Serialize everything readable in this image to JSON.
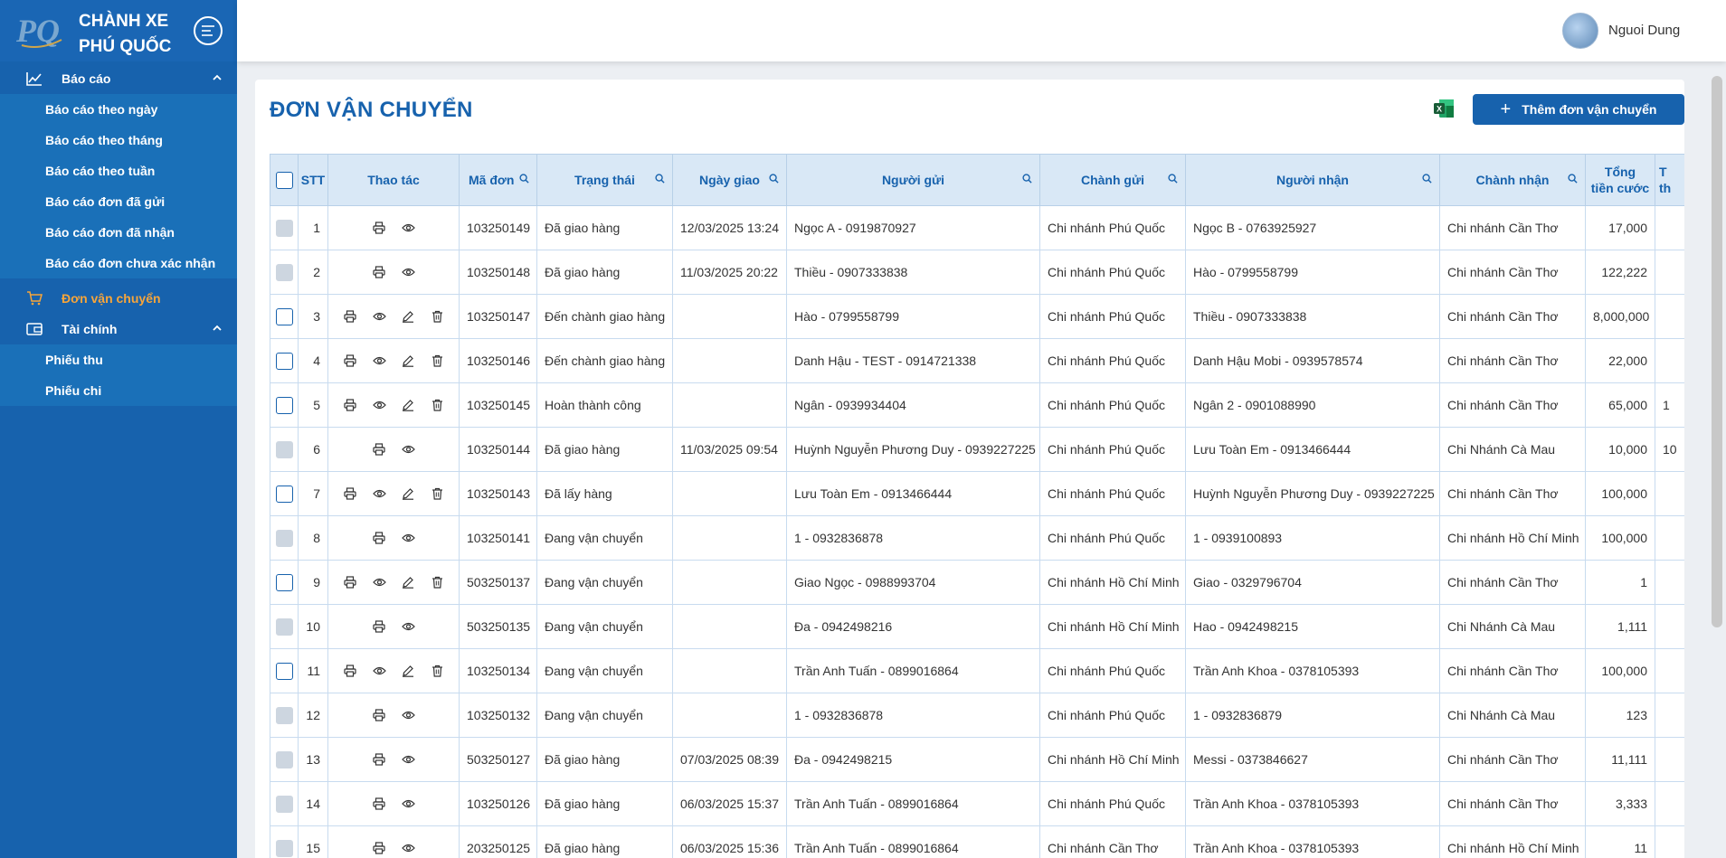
{
  "sidebar": {
    "brand_line1": "CHÀNH XE",
    "brand_line2": "PHÚ QUỐC",
    "logo_text": "PQ",
    "reports": {
      "label": "Báo cáo",
      "items": [
        "Báo cáo theo ngày",
        "Báo cáo theo tháng",
        "Báo cáo theo tuần",
        "Báo cáo đơn đã gửi",
        "Báo cáo đơn đã nhận",
        "Báo cáo đơn chưa xác nhận"
      ]
    },
    "shipping": {
      "label": "Đơn vận chuyển"
    },
    "finance": {
      "label": "Tài chính",
      "items": [
        "Phiếu thu",
        "Phiếu chi"
      ]
    }
  },
  "topbar": {
    "user_name": "Nguoi Dung"
  },
  "page": {
    "title": "ĐƠN VẬN CHUYỂN",
    "add_button": "Thêm đơn vận chuyển"
  },
  "table": {
    "headers": {
      "stt": "STT",
      "actions": "Thao tác",
      "code": "Mã đơn",
      "status": "Trạng thái",
      "delivery_date": "Ngày giao",
      "sender": "Người gửi",
      "send_branch": "Chành gửi",
      "receiver": "Người nhận",
      "receive_branch": "Chành nhận",
      "total_line1": "Tổng",
      "total_line2": "tiền cước",
      "next_line1": "T",
      "next_line2": "th"
    },
    "rows": [
      {
        "stt": "1",
        "editable": false,
        "code": "103250149",
        "status": "Đã giao hàng",
        "date": "12/03/2025 13:24",
        "sender": "Ngọc A - 0919870927",
        "send_branch": "Chi nhánh Phú Quốc",
        "receiver": "Ngọc B - 0763925927",
        "receive_branch": "Chi nhánh Cần Thơ",
        "total": "17,000",
        "next": ""
      },
      {
        "stt": "2",
        "editable": false,
        "code": "103250148",
        "status": "Đã giao hàng",
        "date": "11/03/2025 20:22",
        "sender": "Thiều - 0907333838",
        "send_branch": "Chi nhánh Phú Quốc",
        "receiver": "Hào - 0799558799",
        "receive_branch": "Chi nhánh Cần Thơ",
        "total": "122,222",
        "next": ""
      },
      {
        "stt": "3",
        "editable": true,
        "code": "103250147",
        "status": "Đến chành giao hàng",
        "date": "",
        "sender": "Hào - 0799558799",
        "send_branch": "Chi nhánh Phú Quốc",
        "receiver": "Thiều - 0907333838",
        "receive_branch": "Chi nhánh Cần Thơ",
        "total": "8,000,000",
        "next": ""
      },
      {
        "stt": "4",
        "editable": true,
        "code": "103250146",
        "status": "Đến chành giao hàng",
        "date": "",
        "sender": "Danh Hậu - TEST - 0914721338",
        "send_branch": "Chi nhánh Phú Quốc",
        "receiver": "Danh Hậu Mobi - 0939578574",
        "receive_branch": "Chi nhánh Cần Thơ",
        "total": "22,000",
        "next": ""
      },
      {
        "stt": "5",
        "editable": true,
        "code": "103250145",
        "status": "Hoàn thành công",
        "date": "",
        "sender": "Ngân - 0939934404",
        "send_branch": "Chi nhánh Phú Quốc",
        "receiver": "Ngân 2 - 0901088990",
        "receive_branch": "Chi nhánh Cần Thơ",
        "total": "65,000",
        "next": "1"
      },
      {
        "stt": "6",
        "editable": false,
        "code": "103250144",
        "status": "Đã giao hàng",
        "date": "11/03/2025 09:54",
        "sender": "Huỳnh Nguyễn Phương Duy - 0939227225",
        "send_branch": "Chi nhánh Phú Quốc",
        "receiver": "Lưu Toàn Em - 0913466444",
        "receive_branch": "Chi Nhánh Cà Mau",
        "total": "10,000",
        "next": "10"
      },
      {
        "stt": "7",
        "editable": true,
        "code": "103250143",
        "status": "Đã lấy hàng",
        "date": "",
        "sender": "Lưu Toàn Em - 0913466444",
        "send_branch": "Chi nhánh Phú Quốc",
        "receiver": "Huỳnh Nguyễn Phương Duy - 0939227225",
        "receive_branch": "Chi nhánh Cần Thơ",
        "total": "100,000",
        "next": ""
      },
      {
        "stt": "8",
        "editable": false,
        "code": "103250141",
        "status": "Đang vận chuyển",
        "date": "",
        "sender": "1 - 0932836878",
        "send_branch": "Chi nhánh Phú Quốc",
        "receiver": "1 - 0939100893",
        "receive_branch": "Chi nhánh Hồ Chí Minh",
        "total": "100,000",
        "next": ""
      },
      {
        "stt": "9",
        "editable": true,
        "code": "503250137",
        "status": "Đang vận chuyển",
        "date": "",
        "sender": "Giao Ngọc - 0988993704",
        "send_branch": "Chi nhánh Hồ Chí Minh",
        "receiver": "Giao - 0329796704",
        "receive_branch": "Chi nhánh Cần Thơ",
        "total": "1",
        "next": ""
      },
      {
        "stt": "10",
        "editable": false,
        "code": "503250135",
        "status": "Đang vận chuyển",
        "date": "",
        "sender": "Đa - 0942498216",
        "send_branch": "Chi nhánh Hồ Chí Minh",
        "receiver": "Hao - 0942498215",
        "receive_branch": "Chi Nhánh Cà Mau",
        "total": "1,111",
        "next": ""
      },
      {
        "stt": "11",
        "editable": true,
        "code": "103250134",
        "status": "Đang vận chuyển",
        "date": "",
        "sender": "Trần Anh Tuấn - 0899016864",
        "send_branch": "Chi nhánh Phú Quốc",
        "receiver": "Trần Anh Khoa - 0378105393",
        "receive_branch": "Chi nhánh Cần Thơ",
        "total": "100,000",
        "next": ""
      },
      {
        "stt": "12",
        "editable": false,
        "code": "103250132",
        "status": "Đang vận chuyển",
        "date": "",
        "sender": "1 - 0932836878",
        "send_branch": "Chi nhánh Phú Quốc",
        "receiver": "1 - 0932836879",
        "receive_branch": "Chi Nhánh Cà Mau",
        "total": "123",
        "next": ""
      },
      {
        "stt": "13",
        "editable": false,
        "code": "503250127",
        "status": "Đã giao hàng",
        "date": "07/03/2025 08:39",
        "sender": "Đa - 0942498215",
        "send_branch": "Chi nhánh Hồ Chí Minh",
        "receiver": "Messi - 0373846627",
        "receive_branch": "Chi nhánh Cần Thơ",
        "total": "11,111",
        "next": ""
      },
      {
        "stt": "14",
        "editable": false,
        "code": "103250126",
        "status": "Đã giao hàng",
        "date": "06/03/2025 15:37",
        "sender": "Trần Anh Tuấn - 0899016864",
        "send_branch": "Chi nhánh Phú Quốc",
        "receiver": "Trần Anh Khoa - 0378105393",
        "receive_branch": "Chi nhánh Cần Thơ",
        "total": "3,333",
        "next": ""
      },
      {
        "stt": "15",
        "editable": false,
        "code": "203250125",
        "status": "Đã giao hàng",
        "date": "06/03/2025 15:36",
        "sender": "Trần Anh Tuấn - 0899016864",
        "send_branch": "Chi nhánh Cần Thơ",
        "receiver": "Trần Anh Khoa - 0378105393",
        "receive_branch": "Chi nhánh Hồ Chí Minh",
        "total": "11",
        "next": ""
      }
    ]
  },
  "colors": {
    "primary": "#1762ad",
    "active_menu": "#f7a53a",
    "header_bg": "#d9e8f6",
    "excel_green": "#1d7a45"
  }
}
